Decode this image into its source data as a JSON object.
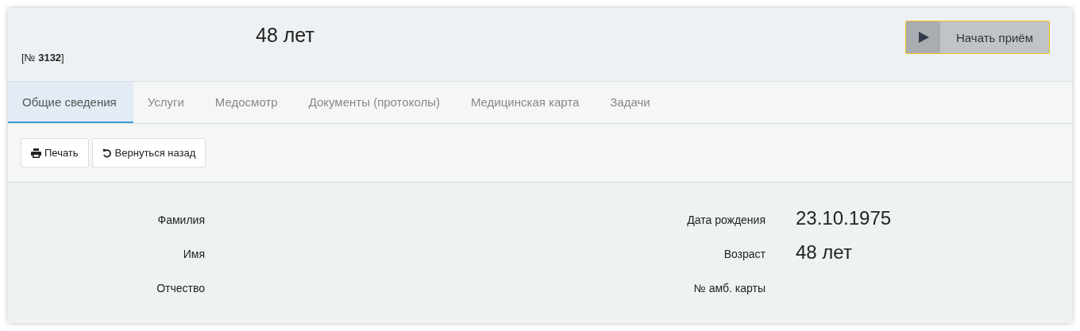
{
  "header": {
    "age": "48 лет",
    "record_number": "[№ **3132**]",
    "start_button": "Начать приём"
  },
  "tabs": [
    {
      "label": "Общие сведения",
      "selected": true
    },
    {
      "label": "Услуги",
      "selected": false
    },
    {
      "label": "Медосмотр",
      "selected": false
    },
    {
      "label": "Документы (протоколы)",
      "selected": false
    },
    {
      "label": "Медицинская карта",
      "selected": false
    },
    {
      "label": "Задачи",
      "selected": false
    }
  ],
  "toolbar": [
    {
      "kind": "print",
      "label": "Печать"
    },
    {
      "kind": "back",
      "label": "Вернуться назад"
    }
  ],
  "fields_left": [
    {
      "label": "Фамилия"
    },
    {
      "label": "Имя"
    },
    {
      "label": "Отчество"
    }
  ],
  "fields_right": [
    {
      "label": "Дата рождения",
      "value": "23.10.1975"
    },
    {
      "label": "Возраст",
      "value": "48 лет"
    },
    {
      "label": "№ амб. карты"
    }
  ]
}
